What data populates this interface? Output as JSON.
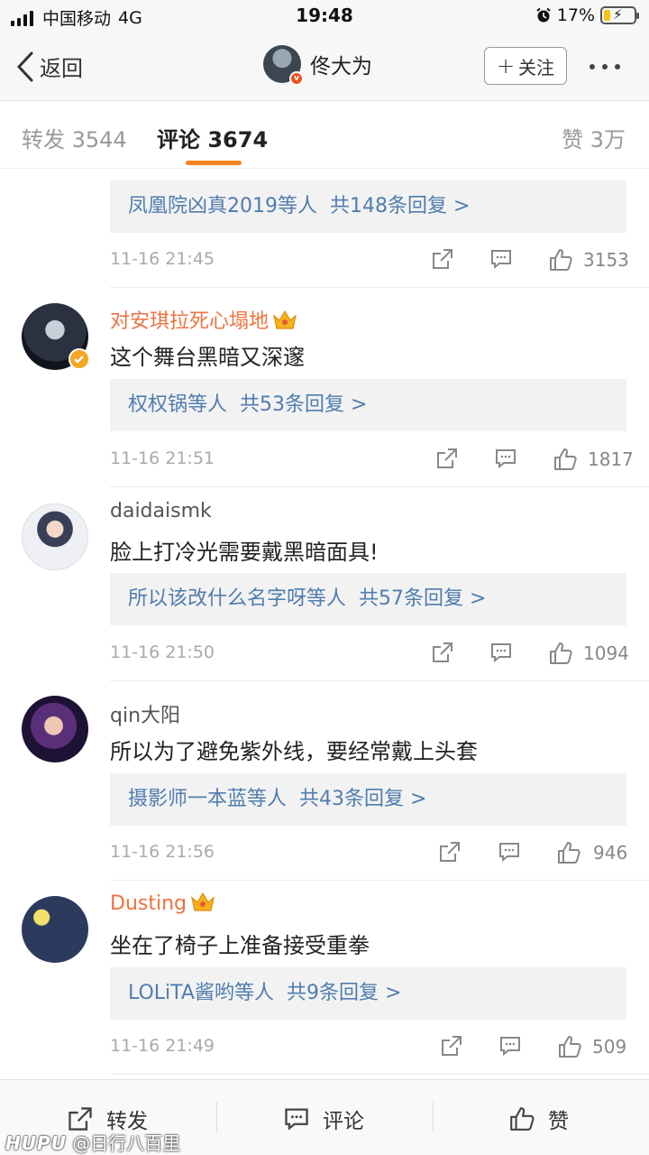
{
  "status_bar": {
    "carrier": "中国移动",
    "network": "4G",
    "time": "19:48",
    "battery_percent": "17%"
  },
  "nav": {
    "back_label": "返回",
    "username": "佟大为",
    "follow_label": "关注"
  },
  "tabs": {
    "repost": "转发 3544",
    "comment": "评论 3674",
    "like": "赞 3万"
  },
  "comments": [
    {
      "reply_from": "凤凰院凶真2019",
      "reply_suffix": "等人",
      "reply_count": "共148条回复 >",
      "time": "11-16 21:45",
      "likes": "3153"
    },
    {
      "username": "对安琪拉死心塌地",
      "text": "这个舞台黑暗又深邃",
      "reply_from": "权权锅",
      "reply_suffix": "等人",
      "reply_count": "共53条回复 >",
      "time": "11-16 21:51",
      "likes": "1817"
    },
    {
      "username": "daidaismk",
      "text": "脸上打冷光需要戴黑暗面具!",
      "reply_from": "所以该改什么名字呀",
      "reply_suffix": "等人",
      "reply_count": "共57条回复 >",
      "time": "11-16 21:50",
      "likes": "1094"
    },
    {
      "username": "qin大阳",
      "text": "所以为了避免紫外线，要经常戴上头套",
      "reply_from": "摄影师一本蓝",
      "reply_suffix": "等人",
      "reply_count": "共43条回复 >",
      "time": "11-16 21:56",
      "likes": "946"
    },
    {
      "username": "Dusting",
      "text": "坐在了椅子上准备接受重拳",
      "reply_from": "LOLiTA酱哟",
      "reply_suffix": "等人",
      "reply_count": "共9条回复 >",
      "time": "11-16 21:49",
      "likes": "509"
    }
  ],
  "bottom_bar": {
    "repost": "转发",
    "comment": "评论",
    "like": "赞"
  },
  "watermark": {
    "brand": "HUPU",
    "handle": "@日行八百里"
  },
  "colors": {
    "accent": "#f5821f",
    "link": "#507daf",
    "vip_name": "#eb7340"
  }
}
